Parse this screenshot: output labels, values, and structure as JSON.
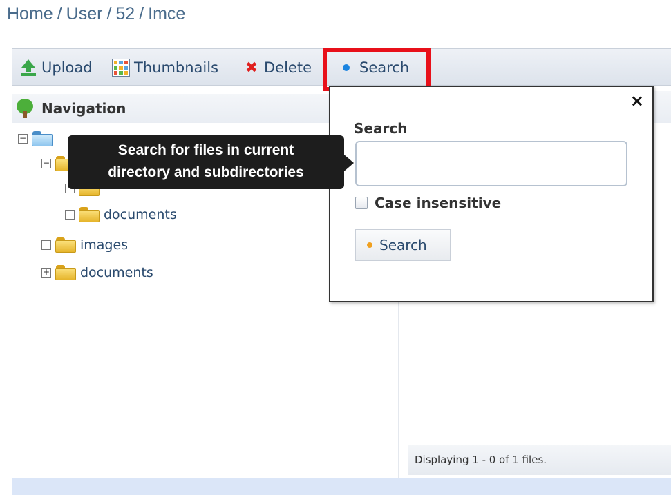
{
  "breadcrumb": {
    "items": [
      "Home",
      "User",
      "52"
    ],
    "current": "Imce"
  },
  "toolbar": {
    "upload_label": "Upload",
    "thumbnails_label": "Thumbnails",
    "delete_label": "Delete",
    "search_label": "Search"
  },
  "navigation": {
    "title": "Navigation",
    "tree": [
      {
        "label": "documents"
      },
      {
        "label": "images"
      },
      {
        "label": "documents"
      }
    ]
  },
  "tooltip": {
    "line1": "Search for files in current",
    "line2": "directory and subdirectories"
  },
  "search_popup": {
    "close_label": "×",
    "field_label": "Search",
    "input_value": "",
    "case_label": "Case insensitive",
    "button_label": "Search"
  },
  "status": {
    "text": "Displaying 1 - 0 of 1 files."
  },
  "colors": {
    "highlight": "#e8101a",
    "link": "#2a4a6e",
    "tooltip_bg": "#1d1d1d"
  }
}
